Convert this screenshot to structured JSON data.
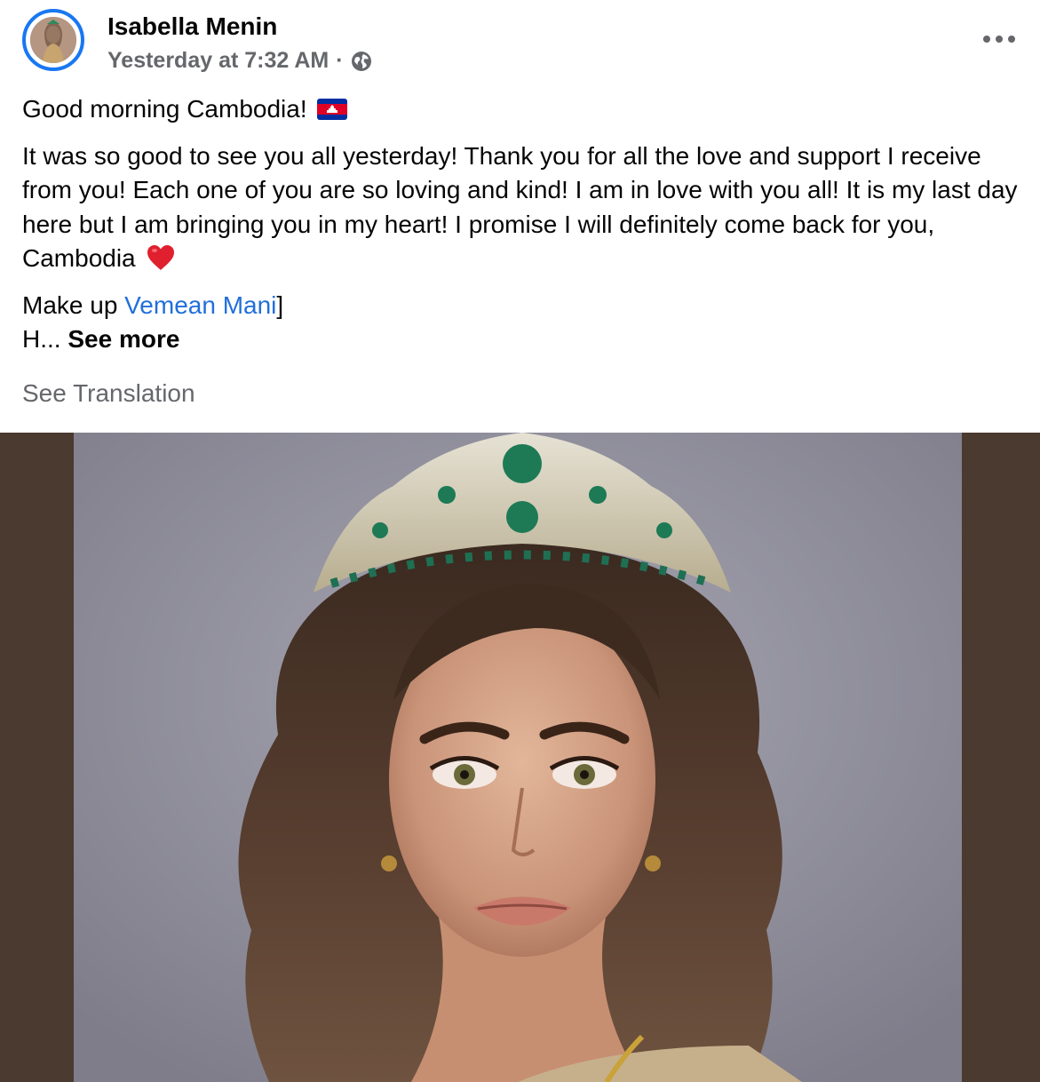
{
  "post": {
    "author": "Isabella Menin",
    "timestamp": "Yesterday at 7:32 AM",
    "separator": "·",
    "privacy_icon": "globe-icon",
    "more_icon": "more-horizontal-icon"
  },
  "content": {
    "greeting": "Good morning Cambodia!",
    "greeting_emoji": "cambodia-flag-icon",
    "paragraph": "It was so good to see you all yesterday! Thank you for all the love and support I receive from you! Each one of you are so loving and kind! I am in love with you all! It is my last day here but I am bringing you in my heart! I promise I will definitely come back for you, Cambodia",
    "paragraph_emoji": "red-heart-icon",
    "makeup_prefix": "Make up ",
    "makeup_mention": "Vemean Mani",
    "makeup_suffix": "]",
    "truncated": "H... ",
    "see_more": "See more"
  },
  "translation": {
    "label": "See Translation"
  },
  "colors": {
    "accent": "#1877f2",
    "mention": "#216fdb",
    "secondary_text": "#65676b",
    "photo_frame": "#4a3a30"
  }
}
